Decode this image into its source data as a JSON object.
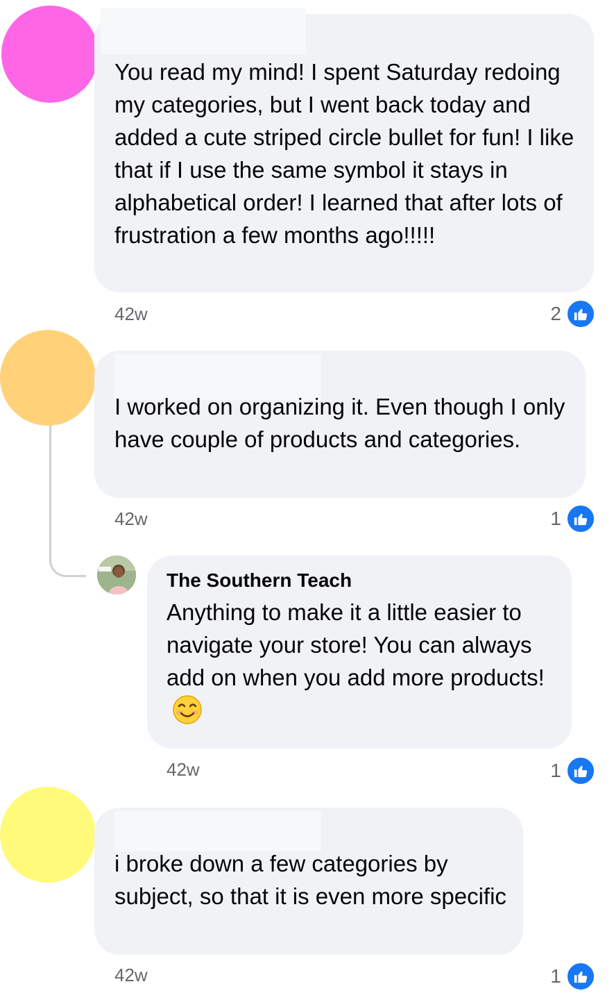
{
  "comments": [
    {
      "avatar_color": "#ff66e6",
      "text": "You read my mind!  I spent Saturday redoing my categories, but I went back today and added a cute striped circle bullet for fun!  I like that if I use the same symbol it stays in alphabetical order!  I learned that after lots of frustration a few months ago!!!!!",
      "time": "42w",
      "likes": "2"
    },
    {
      "avatar_color": "#ffd27a",
      "text": "I worked on organizing it. Even though I only have couple of products and categories.",
      "time": "42w",
      "likes": "1",
      "reply": {
        "author": "The Southern Teach",
        "text": "Anything to make it a little easier to navigate your store! You can always add on when you add more products!",
        "emoji": "smiling-face-emoji",
        "time": "42w",
        "likes": "1"
      }
    },
    {
      "avatar_color": "#fffa7a",
      "text": "i broke down a few categories by subject, so that it is even more specific",
      "time": "42w",
      "likes": "1"
    }
  ],
  "colors": {
    "like_blue": "#1877f2",
    "bubble_bg": "#f0f2f5",
    "meta_text": "#65676b"
  },
  "icons": {
    "like": "thumbs-up-icon"
  }
}
